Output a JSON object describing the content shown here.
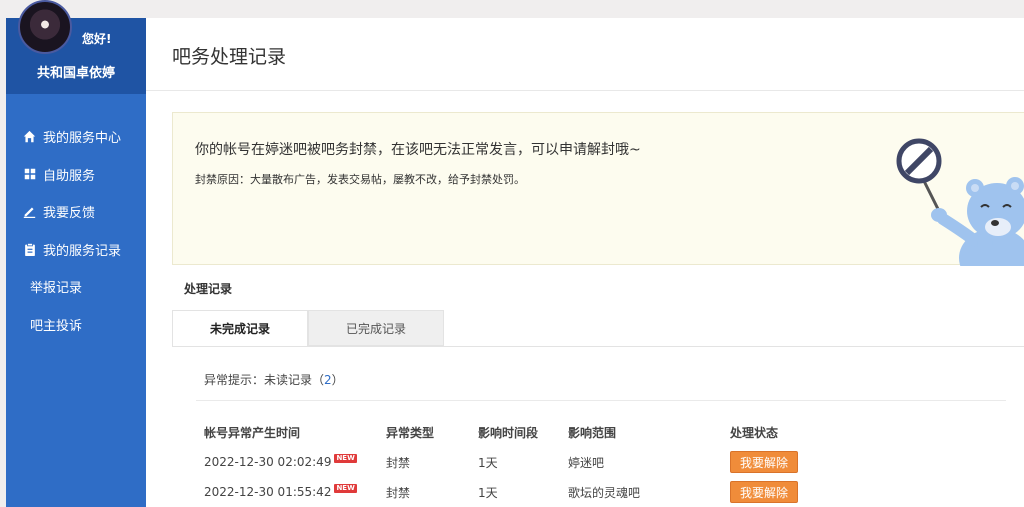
{
  "sidebar": {
    "greeting": "您好!",
    "username": "共和国卓依婷",
    "items": [
      {
        "label": "我的服务中心",
        "icon": "home-icon"
      },
      {
        "label": "自助服务",
        "icon": "grid-icon"
      },
      {
        "label": "我要反馈",
        "icon": "edit-icon"
      },
      {
        "label": "我的服务记录",
        "icon": "clipboard-icon"
      },
      {
        "label": "举报记录"
      },
      {
        "label": "吧主投诉"
      }
    ]
  },
  "main": {
    "title": "吧务处理记录",
    "notice": {
      "message": "你的帐号在婷迷吧被吧务封禁，在该吧无法正常发言，可以申请解封哦~",
      "reason": "封禁原因：大量散布广告，发表交易帖，屡教不改，给予封禁处罚。"
    },
    "section_label": "处理记录",
    "tabs": [
      {
        "label": "未完成记录",
        "active": true
      },
      {
        "label": "已完成记录",
        "active": false
      }
    ],
    "alert": {
      "prefix": "异常提示：未读记录（",
      "count": "2",
      "suffix": "）"
    },
    "table": {
      "headers": [
        "帐号异常产生时间",
        "异常类型",
        "影响时间段",
        "影响范围",
        "处理状态"
      ],
      "new_badge": "NEW",
      "rows": [
        {
          "time": "2022-12-30 02:02:49",
          "type": "封禁",
          "duration": "1天",
          "scope": "婷迷吧",
          "action": "我要解除"
        },
        {
          "time": "2022-12-30 01:55:42",
          "type": "封禁",
          "duration": "1天",
          "scope": "歌坛的灵魂吧",
          "action": "我要解除"
        }
      ]
    }
  },
  "colors": {
    "sidebar": "#2f6dc6",
    "sidebar_head": "#1f54a4",
    "notice_bg": "#fdfcef",
    "button": "#f08c3a",
    "badge": "#e03a3a"
  }
}
